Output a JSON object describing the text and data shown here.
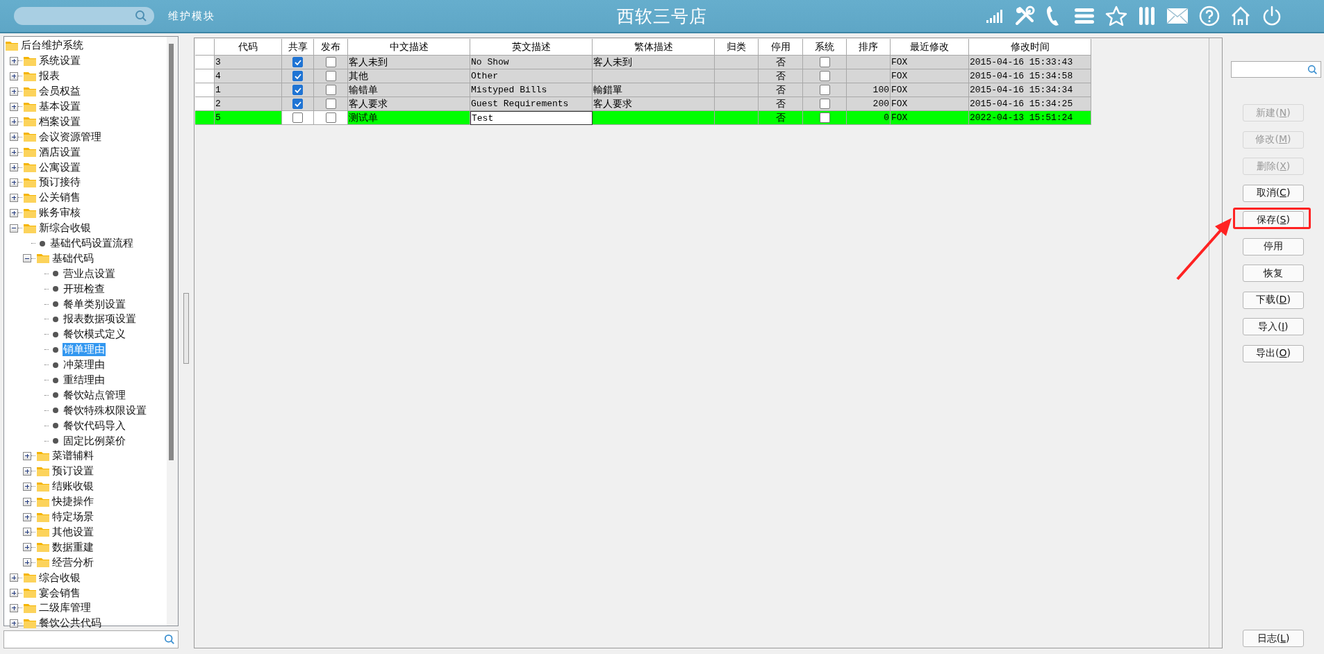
{
  "header": {
    "module": "维护模块",
    "title": "西软三号店"
  },
  "tree": {
    "label": "后台维护系统",
    "kind": "folder",
    "selected": false,
    "children": [
      {
        "label": "系统设置",
        "kind": "folder",
        "expanded": false,
        "selected": false
      },
      {
        "label": "报表",
        "kind": "folder",
        "expanded": false,
        "selected": false
      },
      {
        "label": "会员权益",
        "kind": "folder",
        "expanded": false,
        "selected": false
      },
      {
        "label": "基本设置",
        "kind": "folder",
        "expanded": false,
        "selected": false
      },
      {
        "label": "档案设置",
        "kind": "folder",
        "expanded": false,
        "selected": false
      },
      {
        "label": "会议资源管理",
        "kind": "folder",
        "expanded": false,
        "selected": false
      },
      {
        "label": "酒店设置",
        "kind": "folder",
        "expanded": false,
        "selected": false
      },
      {
        "label": "公寓设置",
        "kind": "folder",
        "expanded": false,
        "selected": false
      },
      {
        "label": "预订接待",
        "kind": "folder",
        "expanded": false,
        "selected": false
      },
      {
        "label": "公关销售",
        "kind": "folder",
        "expanded": false,
        "selected": false
      },
      {
        "label": "账务审核",
        "kind": "folder",
        "expanded": false,
        "selected": false
      },
      {
        "label": "新综合收银",
        "kind": "folder",
        "expanded": true,
        "selected": false,
        "children": [
          {
            "label": "基础代码设置流程",
            "kind": "leaf",
            "selected": false
          },
          {
            "label": "基础代码",
            "kind": "folder",
            "expanded": true,
            "selected": false,
            "children": [
              {
                "label": "营业点设置",
                "kind": "leaf",
                "selected": false
              },
              {
                "label": "开班检查",
                "kind": "leaf",
                "selected": false
              },
              {
                "label": "餐单类别设置",
                "kind": "leaf",
                "selected": false
              },
              {
                "label": "报表数据项设置",
                "kind": "leaf",
                "selected": false
              },
              {
                "label": "餐饮模式定义",
                "kind": "leaf",
                "selected": false
              },
              {
                "label": "销单理由",
                "kind": "leaf",
                "selected": true
              },
              {
                "label": "冲菜理由",
                "kind": "leaf",
                "selected": false
              },
              {
                "label": "重结理由",
                "kind": "leaf",
                "selected": false
              },
              {
                "label": "餐饮站点管理",
                "kind": "leaf",
                "selected": false
              },
              {
                "label": "餐饮特殊权限设置",
                "kind": "leaf",
                "selected": false
              },
              {
                "label": "餐饮代码导入",
                "kind": "leaf",
                "selected": false
              },
              {
                "label": "固定比例菜价",
                "kind": "leaf",
                "selected": false
              }
            ]
          },
          {
            "label": "菜谱辅料",
            "kind": "folder",
            "expanded": false,
            "selected": false
          },
          {
            "label": "预订设置",
            "kind": "folder",
            "expanded": false,
            "selected": false
          },
          {
            "label": "结账收银",
            "kind": "folder",
            "expanded": false,
            "selected": false
          },
          {
            "label": "快捷操作",
            "kind": "folder",
            "expanded": false,
            "selected": false
          },
          {
            "label": "特定场景",
            "kind": "folder",
            "expanded": false,
            "selected": false
          },
          {
            "label": "其他设置",
            "kind": "folder",
            "expanded": false,
            "selected": false
          },
          {
            "label": "数据重建",
            "kind": "folder",
            "expanded": false,
            "selected": false
          },
          {
            "label": "经营分析",
            "kind": "folder",
            "expanded": false,
            "selected": false
          }
        ]
      },
      {
        "label": "综合收银",
        "kind": "folder",
        "expanded": false,
        "selected": false
      },
      {
        "label": "宴会销售",
        "kind": "folder",
        "expanded": false,
        "selected": false
      },
      {
        "label": "二级库管理",
        "kind": "folder",
        "expanded": false,
        "selected": false
      },
      {
        "label": "餐饮公共代码",
        "kind": "folder",
        "expanded": false,
        "selected": false
      }
    ]
  },
  "table": {
    "columns": [
      "代码",
      "共享",
      "发布",
      "中文描述",
      "英文描述",
      "繁体描述",
      "归类",
      "停用",
      "系统",
      "排序",
      "最近修改",
      "修改时间"
    ],
    "rows": [
      {
        "code": "3",
        "shared": true,
        "published": false,
        "cn": "客人未到",
        "en": "No Show",
        "tw": "客人未到",
        "category": "",
        "disabled": "否",
        "system": false,
        "sort": "",
        "modifier": "FOX",
        "time": "2015-04-16 15:33:43",
        "selected": false,
        "editing": false
      },
      {
        "code": "4",
        "shared": true,
        "published": false,
        "cn": "其他",
        "en": "Other",
        "tw": "",
        "category": "",
        "disabled": "否",
        "system": false,
        "sort": "",
        "modifier": "FOX",
        "time": "2015-04-16 15:34:58",
        "selected": false,
        "editing": false
      },
      {
        "code": "1",
        "shared": true,
        "published": false,
        "cn": "输错单",
        "en": "Mistyped Bills",
        "tw": "輸錯單",
        "category": "",
        "disabled": "否",
        "system": false,
        "sort": "100",
        "modifier": "FOX",
        "time": "2015-04-16 15:34:34",
        "selected": false,
        "editing": false
      },
      {
        "code": "2",
        "shared": true,
        "published": false,
        "cn": "客人要求",
        "en": "Guest Requirements",
        "tw": "客人要求",
        "category": "",
        "disabled": "否",
        "system": false,
        "sort": "200",
        "modifier": "FOX",
        "time": "2015-04-16 15:34:25",
        "selected": false,
        "editing": false
      },
      {
        "code": "5",
        "shared": false,
        "published": false,
        "cn": "测试单",
        "en": "Test",
        "tw": "",
        "category": "",
        "disabled": "否",
        "system": false,
        "sort": "0",
        "modifier": "FOX",
        "time": "2022-04-13 15:51:24",
        "selected": true,
        "editing": true
      }
    ]
  },
  "buttons": [
    {
      "label": "新建",
      "shortcut": "(N)",
      "disabled": true,
      "highlighted": false
    },
    {
      "label": "修改",
      "shortcut": "(M)",
      "disabled": true,
      "highlighted": false
    },
    {
      "label": "删除",
      "shortcut": "(X)",
      "disabled": true,
      "highlighted": false
    },
    {
      "label": "取消",
      "shortcut": "(C)",
      "disabled": false,
      "highlighted": false
    },
    {
      "label": "保存",
      "shortcut": "(S)",
      "disabled": false,
      "highlighted": true
    },
    {
      "label": "停用",
      "disabled": false,
      "highlighted": false
    },
    {
      "label": "恢复",
      "disabled": false,
      "highlighted": false
    },
    {
      "label": "下载",
      "shortcut": "(D)",
      "disabled": false,
      "highlighted": false
    },
    {
      "label": "导入",
      "shortcut": "(I)",
      "disabled": false,
      "highlighted": false
    },
    {
      "label": "导出",
      "shortcut": "(O)",
      "disabled": false,
      "highlighted": false
    }
  ],
  "log_button": {
    "label": "日志",
    "shortcut": "(L)"
  }
}
